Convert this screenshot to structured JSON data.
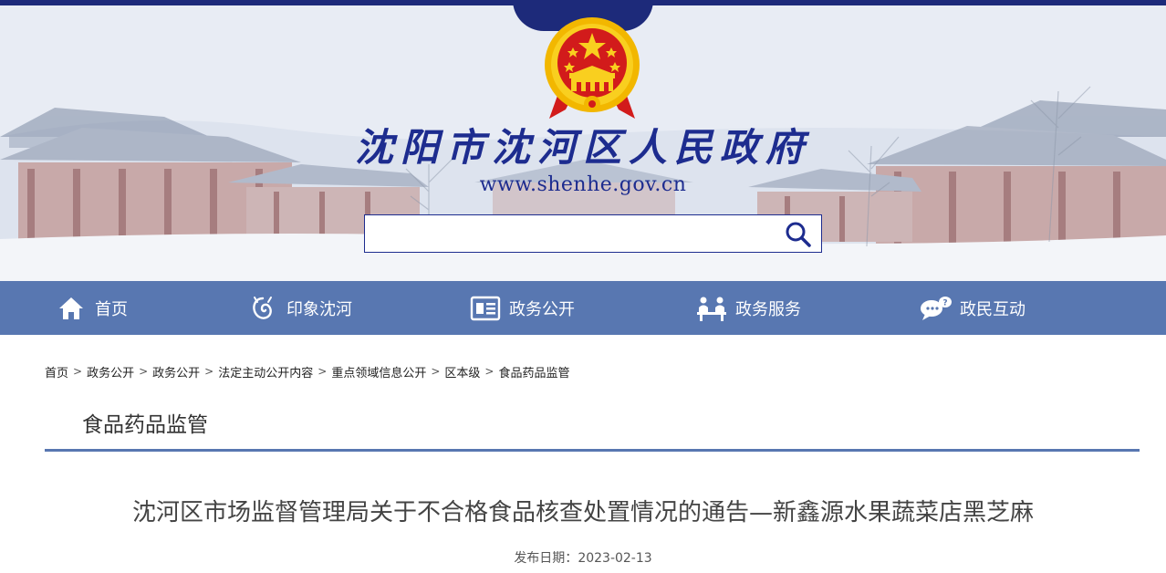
{
  "header": {
    "site_title": "沈阳市沈河区人民政府",
    "site_url": "www.shenhe.gov.cn",
    "search_placeholder": "",
    "colors": {
      "brand_blue": "#1d2c8f",
      "nav_bg": "#5877b1",
      "emblem_red": "#d21b1b",
      "emblem_gold": "#f5c000"
    }
  },
  "nav": {
    "items": [
      {
        "label": "首页",
        "icon": "home-icon"
      },
      {
        "label": "印象沈河",
        "icon": "swirl-emblem-icon"
      },
      {
        "label": "政务公开",
        "icon": "document-board-icon"
      },
      {
        "label": "政务服务",
        "icon": "service-counter-icon"
      },
      {
        "label": "政民互动",
        "icon": "chat-bubble-icon"
      }
    ]
  },
  "breadcrumb": {
    "items": [
      "首页",
      "政务公开",
      "政务公开",
      "法定主动公开内容",
      "重点领域信息公开",
      "区本级",
      "食品药品监管"
    ],
    "separator": ">"
  },
  "section": {
    "title": "食品药品监管"
  },
  "article": {
    "title": "沈河区市场监督管理局关于不合格食品核查处置情况的通告—新鑫源水果蔬菜店黑芝麻",
    "date_label": "发布日期：",
    "date": "2023-02-13"
  }
}
